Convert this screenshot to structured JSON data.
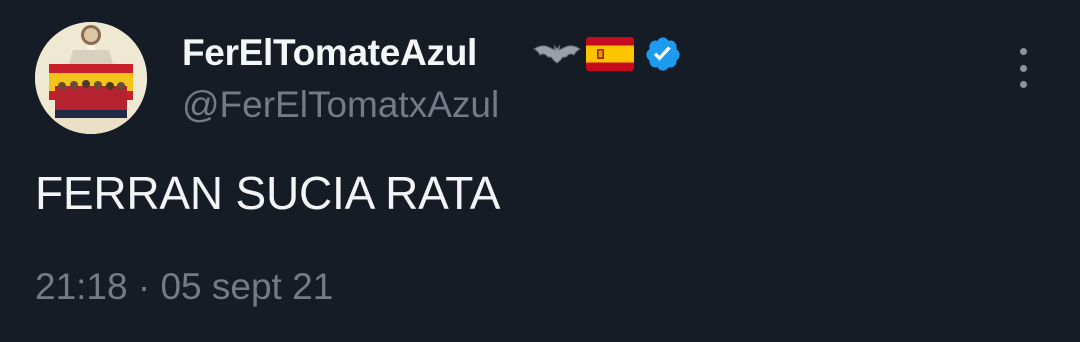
{
  "tweet": {
    "display_name": "FerElTomateAzul",
    "name_icons": [
      "bat-icon",
      "spain-flag-icon",
      "verified-badge-icon"
    ],
    "handle": "@FerElTomatxAzul",
    "text": "FERRAN SUCIA RATA",
    "timestamp": "21:18 · 05 sept 21",
    "more_icon": "more-vertical-icon"
  },
  "colors": {
    "background": "#161c26",
    "primary_text": "#f5f6f7",
    "secondary_text": "#727b86",
    "verified_blue": "#1d9bf0"
  }
}
